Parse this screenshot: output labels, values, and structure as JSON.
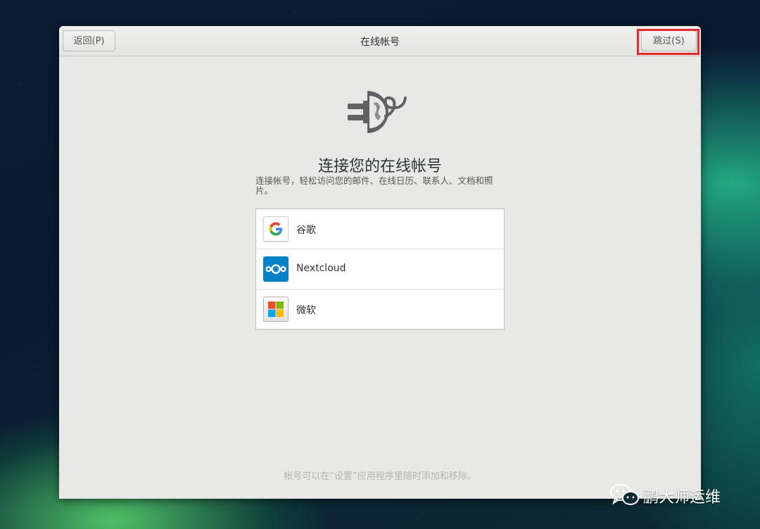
{
  "window": {
    "title": "在线帐号",
    "back_label": "返回(P)",
    "skip_label": "跳过(S)"
  },
  "main": {
    "heading": "连接您的在线帐号",
    "description": "连接帐号，轻松访问您的邮件、在线日历、联系人、文档和照片。",
    "providers": [
      {
        "label": "谷歌",
        "icon": "google-icon"
      },
      {
        "label": "Nextcloud",
        "icon": "nextcloud-icon"
      },
      {
        "label": "微软",
        "icon": "microsoft-icon"
      }
    ],
    "footer_note": "帐号可以在“设置”应用程序里随时添加和移除。"
  },
  "watermark": {
    "text": "鹏大师运维",
    "icon": "wechat-icon"
  },
  "colors": {
    "highlight": "#e8292f",
    "nextcloud": "#0082c9"
  }
}
